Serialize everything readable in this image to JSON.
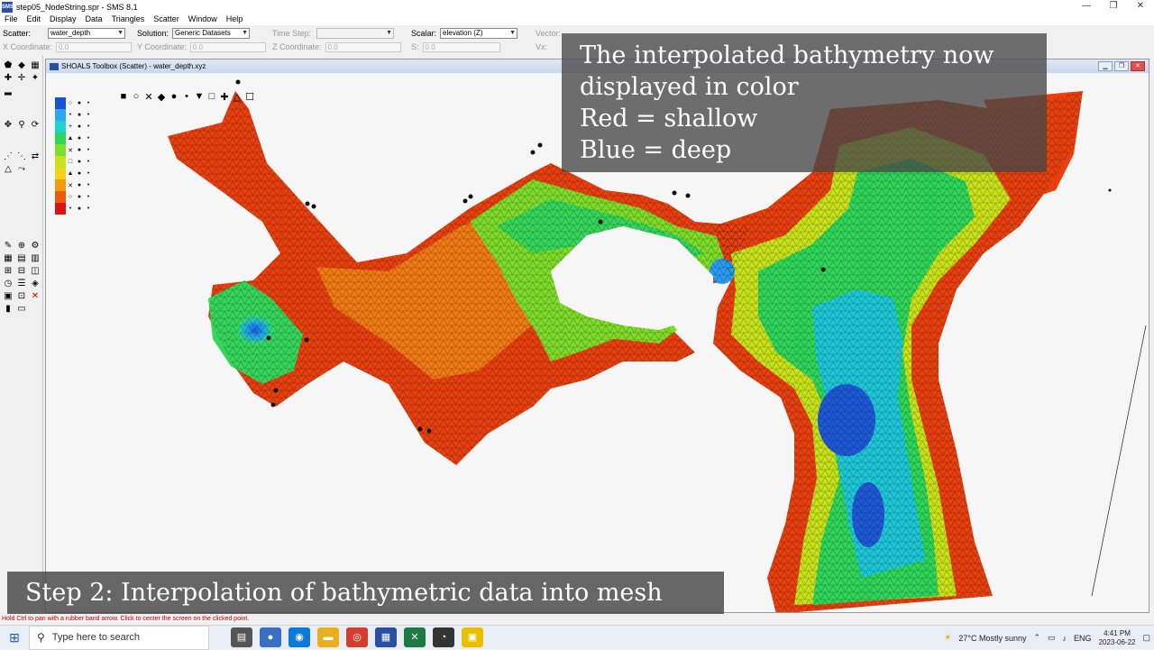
{
  "window": {
    "title": "step05_NodeString.spr - SMS 8.1",
    "app_icon_label": "SMS",
    "minimize": "—",
    "maximize": "❐",
    "close": "✕"
  },
  "menu": [
    "File",
    "Edit",
    "Display",
    "Data",
    "Triangles",
    "Scatter",
    "Window",
    "Help"
  ],
  "options": {
    "scatter_label": "Scatter:",
    "scatter_value": "water_depth",
    "solution_label": "Solution:",
    "solution_value": "Generic Datasets",
    "timestep_label": "Time Step:",
    "timestep_value": "",
    "scalar_label": "Scalar:",
    "scalar_value": "elevation (Z)",
    "vector_label": "Vector:",
    "vector_value": "",
    "x_coord_label": "X Coordinate:",
    "x_coord_value": "0.0",
    "y_coord_label": "Y Coordinate:",
    "y_coord_value": "0.0",
    "z_coord_label": "Z Coordinate:",
    "z_coord_value": "0.0",
    "s_label": "S:",
    "s_value": "0.0",
    "vx_label": "Vx:",
    "vx_value": "0.0"
  },
  "document": {
    "title": "SHOALS Toolbox (Scatter) - water_depth.xyz"
  },
  "overlays": {
    "top_line1": "The interpolated bathymetry now",
    "top_line2": "displayed in color",
    "top_line3": "Red = shallow",
    "top_line4": "Blue = deep",
    "bottom": "Step 2: Interpolation of bathymetric data into mesh"
  },
  "legend_colors": [
    "#1a4fd6",
    "#2aa8f0",
    "#1fd1d1",
    "#2fd65a",
    "#7be02a",
    "#c8e21a",
    "#f2d21a",
    "#f29a12",
    "#ec5a0e",
    "#d81414"
  ],
  "status": {
    "text": "Hold Ctrl to pan with a rubber band arrow.  Click to center the screen on the clicked point."
  },
  "taskbar": {
    "search_placeholder": "Type here to search",
    "weather": "27°C  Mostly sunny",
    "lang": "ENG",
    "time": "4:41 PM",
    "date": "2023-06-22"
  }
}
